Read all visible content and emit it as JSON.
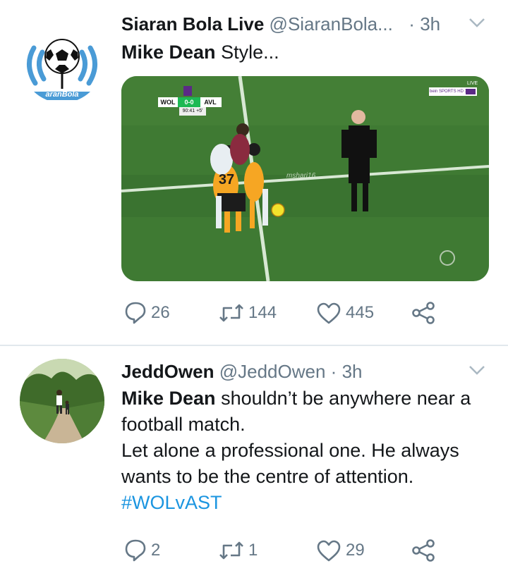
{
  "tweets": [
    {
      "display_name": "Siaran Bola Live",
      "handle": "@SiaranBola...",
      "dot": "·",
      "time": "3h",
      "mention": "Mike Dean",
      "text": " Style...",
      "avatar_text": "aranBola",
      "media": {
        "scoreboard_home": "WOL",
        "scoreboard_score": "0-0",
        "scoreboard_away": "AVL",
        "scoreboard_clock": "90:41",
        "scoreboard_added": "+5'",
        "broadcaster": "bein SPORTS HD 1",
        "live_label": "LIVE",
        "player_number": "37",
        "watermark": "mshari16"
      },
      "replies": "26",
      "retweets": "144",
      "likes": "445"
    },
    {
      "display_name": "JeddOwen",
      "handle": "@JeddOwen",
      "dot": "·",
      "time": "3h",
      "mention": "Mike Dean",
      "text_line1": " shouldn’t be anywhere near a",
      "text_line2": "football match.",
      "text_line3": "Let alone a professional one. He always",
      "text_line4": "wants to be the centre of attention.",
      "hashtag": "#WOLvAST",
      "replies": "2",
      "retweets": "1",
      "likes": "29"
    }
  ],
  "colors": {
    "text": "#14171a",
    "secondary": "#657786",
    "link": "#1b95e0",
    "divider": "#e1e8ed",
    "pitch": "#3f7a33"
  }
}
